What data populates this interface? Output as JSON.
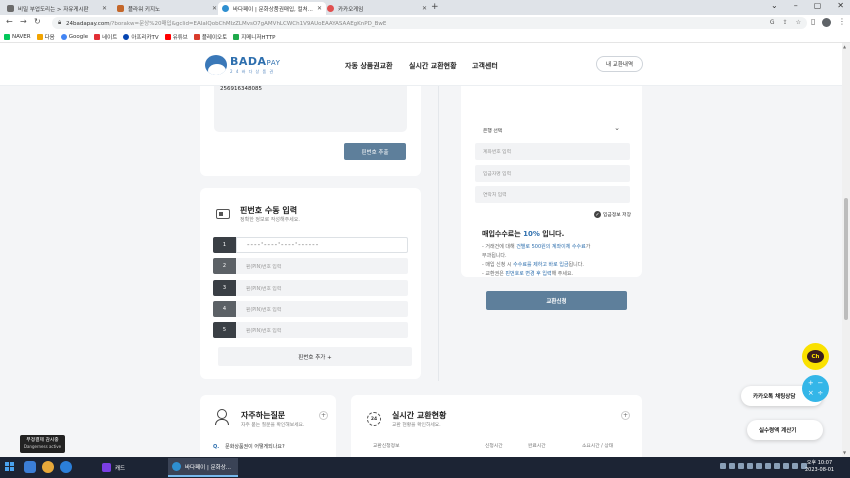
{
  "browser": {
    "tabs": [
      {
        "label": "비밀 부업도리는 > 자유게시판",
        "color": "#6b6b6b"
      },
      {
        "label": "플라워 키지노",
        "color": "#c4672a"
      },
      {
        "label": "바다페이 | 문화상품권매입, 컬처...",
        "color": "#2e8fd0"
      },
      {
        "label": "카카오게임",
        "color": "#e04f4f"
      }
    ],
    "url_host": "24badapay.com",
    "url_rest": "/?borakw=문상%20매입&gclid=EAIaIQobChMIzZLMvsO7gAMVhLCWCh1V9AUoEAAYASAAEgKnPD_BwE",
    "bookmarks": [
      {
        "label": "NAVER",
        "color": "#03c75a"
      },
      {
        "label": "다음",
        "color": "#f2a400"
      },
      {
        "label": "Google",
        "color": "#4285f4"
      },
      {
        "label": "네이트",
        "color": "#e22f35"
      },
      {
        "label": "아프리카TV",
        "color": "#0545b1"
      },
      {
        "label": "유튜브",
        "color": "#ff0000"
      },
      {
        "label": "플레이오토",
        "color": "#d93b2b"
      },
      {
        "label": "지메니저HTTP",
        "color": "#1fa94b"
      }
    ]
  },
  "header": {
    "logo_title": "BADA",
    "logo_pay": "PAY",
    "logo_sub": "2 4 바 다 상 품 권",
    "menu": [
      "자동 상품권교환",
      "실시간 교환현황",
      "고객센터"
    ],
    "history_button": "내 교환내역"
  },
  "pin_box": {
    "value": "256916348085",
    "extract_button": "핀번호 추출"
  },
  "manual": {
    "title": "핀번호 수동 입력",
    "subtitle": "정확한 정보로 작성해주세요.",
    "rows": [
      {
        "num": "1",
        "text": "----'----'----'------",
        "color": "#3a3f45"
      },
      {
        "num": "2",
        "text": "핀(PIN)번호 입력",
        "color": "#5c6166"
      },
      {
        "num": "3",
        "text": "핀(PIN)번호 입력",
        "color": "#3a3f45"
      },
      {
        "num": "4",
        "text": "핀(PIN)번호 입력",
        "color": "#5c6166"
      },
      {
        "num": "5",
        "text": "핀(PIN)번호 입력",
        "color": "#3a3f45"
      }
    ],
    "add_button": "핀번호 추가 +"
  },
  "form": {
    "bank_select": "은행 선택",
    "account_placeholder": "계좌번호 입력",
    "holder_placeholder": "입금자명 입력",
    "phone_placeholder": "연락처 입력",
    "save_info": "입금정보 저장",
    "fee_prefix": "매입수수료는",
    "fee_rate": "10%",
    "fee_suffix": "입니다.",
    "notes": [
      [
        "- 거래건에 대해 ",
        "건별로 500원의 계좌이체 수수료",
        "가"
      ],
      [
        "  부과됩니다.",
        "",
        ""
      ],
      [
        "- 매입 신청 시 ",
        "수수료를 제하고 바로 입금",
        "됩니다."
      ],
      [
        "- 교환권은 ",
        "핀번호로 변경 후 입력",
        "해 주세요."
      ]
    ],
    "apply_button": "교환신청"
  },
  "faq": {
    "title": "자주하는질문",
    "subtitle": "자주 묻는 질문을 확인해보세요.",
    "q_label": "Q.",
    "first_question": "문화상품권이 어떻게되나요?"
  },
  "exchange": {
    "icon_label": "24",
    "title": "실시간 교환현황",
    "subtitle": "교환 현황을 확인하세요.",
    "columns": [
      "교환신청정보",
      "신청시간",
      "완료시간",
      "소요시간 / 상태"
    ]
  },
  "floating": {
    "kakao_label": "카카오톡 채팅상담",
    "kakao_icon": "Ch",
    "calc_label": "실수령액 계산기"
  },
  "badge": {
    "line1": "부정결제 감시중",
    "line2": "Dangerness active"
  },
  "taskbar": {
    "apps": [
      {
        "label": "캐드",
        "color": "#7b3fe4"
      },
      {
        "label": "바다페이 | 문화상...",
        "color": "#2e8fd0"
      }
    ],
    "time": "오후 10:07",
    "date": "2023-08-01"
  }
}
